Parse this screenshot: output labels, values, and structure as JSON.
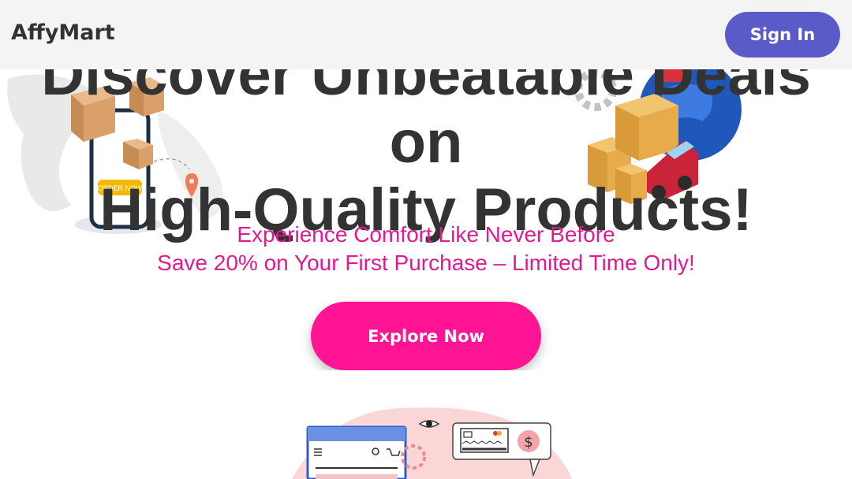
{
  "navbar": {
    "brand": "AffyMart",
    "signin_label": "Sign In"
  },
  "hero": {
    "heading_line1": "Discover Unbeatable Deals on",
    "heading_line2": "High-Quality Products!",
    "subtitle_line1": "Experience Comfort Like Never Before",
    "subtitle_line2": "Save 20% on Your First Purchase – Limited Time Only!",
    "cta_label": "Explore Now"
  },
  "illustrations": {
    "phone_button_label": "ORDER NOW",
    "price_symbol": "$"
  },
  "colors": {
    "brand_purple": "#5a5bc9",
    "accent_pink": "#ff1493",
    "subtitle_pink": "#e01a8f",
    "heading": "#333333",
    "navbar_bg": "#f4f4f4"
  }
}
